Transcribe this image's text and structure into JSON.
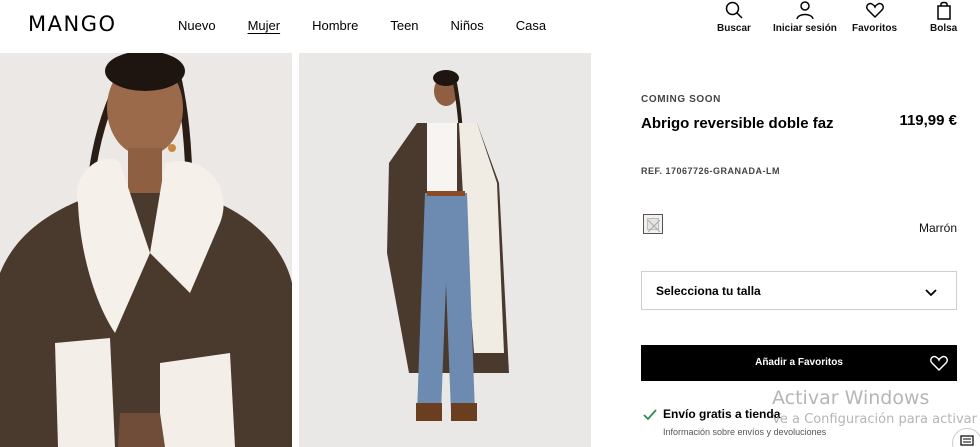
{
  "brand": {
    "logo": "MANGO"
  },
  "nav": {
    "items": [
      {
        "label": "Nuevo"
      },
      {
        "label": "Mujer",
        "active": true
      },
      {
        "label": "Hombre"
      },
      {
        "label": "Teen"
      },
      {
        "label": "Niños"
      },
      {
        "label": "Casa"
      }
    ]
  },
  "tools": {
    "search": {
      "label": "Buscar",
      "icon": "search-icon"
    },
    "login": {
      "label": "Iniciar sesión",
      "icon": "user-icon"
    },
    "favorites": {
      "label": "Favoritos",
      "icon": "heart-icon"
    },
    "bag": {
      "label": "Bolsa",
      "icon": "bag-icon"
    }
  },
  "product": {
    "badge": "COMING SOON",
    "name": "Abrigo reversible doble faz",
    "price": "119,99 €",
    "ref": "REF. 17067726-GRANADA-LM",
    "color": "Marrón",
    "size_placeholder": "Selecciona tu talla",
    "add_favorites": "Añadir a Favoritos",
    "shipping": "Envío gratis a tienda",
    "shipping_info": "Información sobre envíos y devoluciones"
  },
  "images": [
    {
      "alt": "model close-up wearing shearling coat"
    },
    {
      "alt": "model full length wearing coat and jeans"
    }
  ],
  "watermark": {
    "title": "Activar Windows",
    "subtitle": "Ve a Configuración para activar Windows."
  },
  "colors": {
    "brand_black": "#000000",
    "swatch_border": "#555555",
    "coat_brown": "#4a3a2e",
    "shearling": "#f5f1ea",
    "denim": "#6d8bb0"
  }
}
